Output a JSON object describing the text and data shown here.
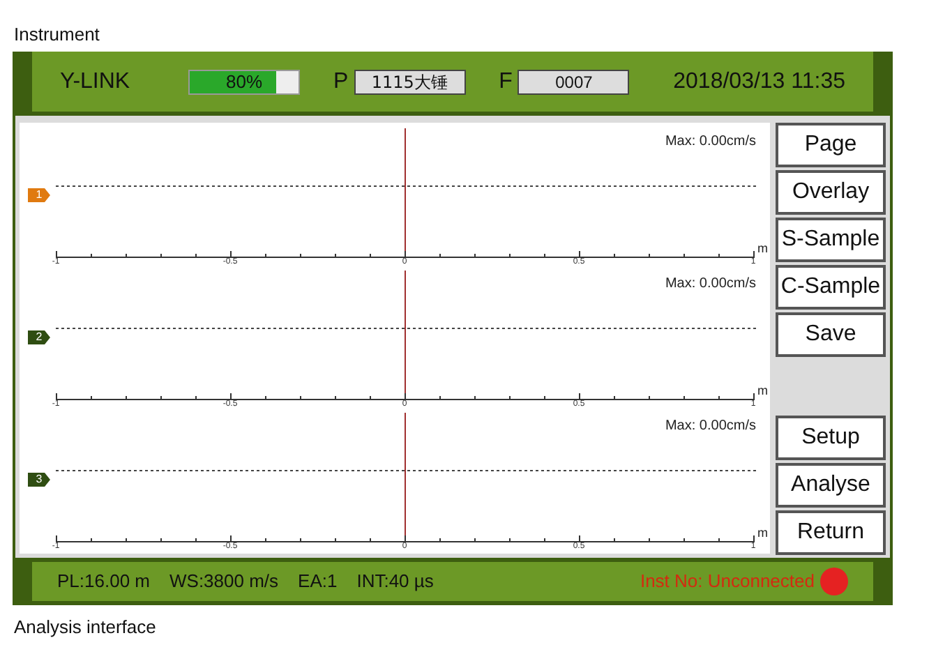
{
  "captions": {
    "top": "Instrument",
    "bottom": "Analysis interface"
  },
  "header": {
    "brand": "Y-LINK",
    "battery": {
      "level": 0.8,
      "reading": "80%"
    },
    "p_label": "P",
    "p_value": "1115大锤",
    "f_label": "F",
    "f_value": "0007",
    "datetime": "2018/03/13 11:35"
  },
  "plots": [
    {
      "marker": "1",
      "color": "#e07a10",
      "max": "Max: 0.00cm/s",
      "ticks": [
        "-1",
        "-0.5",
        "0",
        "0.5",
        "1"
      ],
      "unit": "m"
    },
    {
      "marker": "2",
      "color": "#2f4d12",
      "max": "Max: 0.00cm/s",
      "ticks": [
        "-1",
        "-0.5",
        "0",
        "0.5",
        "1"
      ],
      "unit": "m"
    },
    {
      "marker": "3",
      "color": "#2f4d12",
      "max": "Max: 0.00cm/s",
      "ticks": [
        "-1",
        "-0.5",
        "0",
        "0.5",
        "1"
      ],
      "unit": "m"
    }
  ],
  "buttons_top": [
    "Page",
    "Overlay",
    "S-Sample",
    "C-Sample",
    "Save"
  ],
  "buttons_bottom": [
    "Setup",
    "Analyse",
    "Return"
  ],
  "status_bar": {
    "items": [
      "PL:16.00 m",
      "WS:3800 m/s",
      "EA:1",
      "INT:40 µs"
    ],
    "connection": "Inst No: Unconnected",
    "connected": false
  }
}
